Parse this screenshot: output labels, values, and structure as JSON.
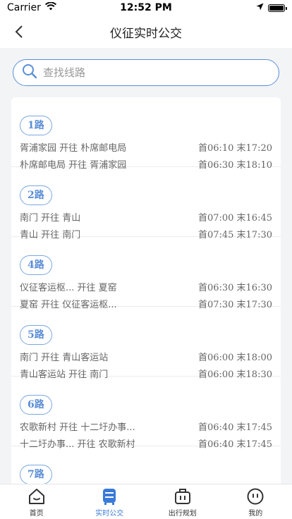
{
  "status_bar": {
    "carrier": "Carrier",
    "time": "12:52 PM"
  },
  "nav": {
    "title": "仪征实时公交"
  },
  "search": {
    "placeholder": "查找线路"
  },
  "routes": [
    {
      "name": "1路",
      "line1": {
        "desc": "胥浦家园 开往 朴席邮电局",
        "times": "首06:10 末17:20"
      },
      "line2": {
        "desc": "朴席邮电局 开往 胥浦家园",
        "times": "首06:30 末18:10"
      }
    },
    {
      "name": "2路",
      "line1": {
        "desc": "南门 开往 青山",
        "times": "首07:00 末16:45"
      },
      "line2": {
        "desc": "青山 开往 南门",
        "times": "首07:45 末17:30"
      }
    },
    {
      "name": "4路",
      "line1": {
        "desc": "仪征客运枢... 开往 夏窑",
        "times": "首06:30 末16:30"
      },
      "line2": {
        "desc": "夏窑 开往 仪征客运枢...",
        "times": "首07:30 末17:30"
      }
    },
    {
      "name": "5路",
      "line1": {
        "desc": "南门 开往 青山客运站",
        "times": "首06:00 末18:00"
      },
      "line2": {
        "desc": "青山客运站 开往 南门",
        "times": "首06:00 末18:30"
      }
    },
    {
      "name": "6路",
      "line1": {
        "desc": "农歌新村 开往 十二圩办事...",
        "times": "首06:40 末17:45"
      },
      "line2": {
        "desc": "十二圩办事... 开往 农歌新村",
        "times": "首06:40 末17:45"
      }
    },
    {
      "name": "7路"
    }
  ],
  "tabs": [
    {
      "label": "首页",
      "icon": "home-icon"
    },
    {
      "label": "实时公交",
      "icon": "bus-icon",
      "active": true
    },
    {
      "label": "出行规划",
      "icon": "luggage-icon"
    },
    {
      "label": "我的",
      "icon": "face-icon"
    }
  ],
  "colors": {
    "accent": "#3a7ad9",
    "badge": "#5b8ed6"
  }
}
